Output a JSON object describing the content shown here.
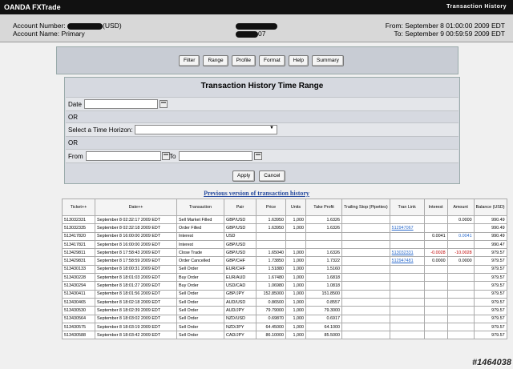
{
  "app": {
    "title": "OANDA FXTrade",
    "section": "Transaction History"
  },
  "account": {
    "number_label": "Account Number:",
    "number_suffix": "(USD)",
    "name_label": "Account Name: Primary",
    "mid_suffix": "07",
    "from": "From: September 8 01:00:00 2009 EDT",
    "to": "To: September 9 00:59:59 2009 EDT"
  },
  "toolbar": [
    "Filter",
    "Range",
    "Profile",
    "Format",
    "Help",
    "Summary"
  ],
  "range": {
    "title": "Transaction History Time Range",
    "date_label": "Date",
    "or1": "OR",
    "horizon_label": "Select a Time Horizon:",
    "or2": "OR",
    "from_label": "From",
    "to_label": "To",
    "apply": "Apply",
    "cancel": "Cancel"
  },
  "prev_link": "Previous version of transaction history",
  "table": {
    "headers": [
      "Ticket++",
      "Date++",
      "Transaction",
      "Pair",
      "Price",
      "Units",
      "Take Profit",
      "Trailing Stop (Pipettes)",
      "Tran Link",
      "Interest",
      "Amount",
      "Balance (USD)"
    ],
    "rows": [
      [
        "513032331",
        "September 8 02:32:17 2009 EDT",
        "Sell Market Filled",
        "GBP/USD",
        "1.63950",
        "1,000",
        "1.6326",
        "",
        "",
        "",
        "0.0000",
        "990.49"
      ],
      [
        "513032335",
        "September 8 02:32:18 2009 EDT",
        "Order Filled",
        "GBP/USD",
        "1.63950",
        "1,000",
        "1.6326",
        "",
        "512947067",
        "",
        "",
        "990.49"
      ],
      [
        "513417820",
        "September 8 16:00:00 2009 EDT",
        "Interest",
        "USD",
        "",
        "",
        "",
        "",
        "",
        "0.0041",
        "0.0041",
        "990.49"
      ],
      [
        "513417821",
        "September 8 16:00:00 2009 EDT",
        "Interest",
        "GBP/USD",
        "",
        "",
        "",
        "",
        "",
        "",
        "",
        "990.47"
      ],
      [
        "513429811",
        "September 8 17:58:43 2009 EDT",
        "Close Trade",
        "GBP/USD",
        "1.65040",
        "1,000",
        "1.6326",
        "",
        "513032331",
        "-0.0028",
        "-10.0028",
        "979.57"
      ],
      [
        "513429831",
        "September 8 17:58:59 2009 EDT",
        "Order Cancelled",
        "GBP/CHF",
        "1.73850",
        "1,000",
        "1.7322",
        "",
        "512947481",
        "0.0000",
        "0.0000",
        "979.57"
      ],
      [
        "513430133",
        "September 8 18:00:31 2009 EDT",
        "Sell Order",
        "EUR/CHF",
        "1.51880",
        "1,000",
        "1.5160",
        "",
        "",
        "",
        "",
        "979.57"
      ],
      [
        "513430228",
        "September 8 18:01:03 2009 EDT",
        "Buy Order",
        "EUR/AUD",
        "1.67480",
        "1,000",
        "1.6818",
        "",
        "",
        "",
        "",
        "979.57"
      ],
      [
        "513430294",
        "September 8 18:01:27 2009 EDT",
        "Buy Order",
        "USD/CAD",
        "1.06980",
        "1,000",
        "1.0818",
        "",
        "",
        "",
        "",
        "979.57"
      ],
      [
        "513430411",
        "September 8 18:01:56 2009 EDT",
        "Sell Order",
        "GBP/JPY",
        "152.85000",
        "1,000",
        "151.8500",
        "",
        "",
        "",
        "",
        "979.57"
      ],
      [
        "513430465",
        "September 8 18:02:18 2009 EDT",
        "Sell Order",
        "AUD/USD",
        "0.86500",
        "1,000",
        "0.8557",
        "",
        "",
        "",
        "",
        "979.57"
      ],
      [
        "513430530",
        "September 8 18:02:39 2009 EDT",
        "Sell Order",
        "AUD/JPY",
        "79.79000",
        "1,000",
        "79.3000",
        "",
        "",
        "",
        "",
        "979.57"
      ],
      [
        "513430564",
        "September 8 18:03:02 2009 EDT",
        "Sell Order",
        "NZD/USD",
        "0.69870",
        "1,000",
        "0.6917",
        "",
        "",
        "",
        "",
        "979.57"
      ],
      [
        "513430575",
        "September 8 18:03:19 2009 EDT",
        "Sell Order",
        "NZD/JPY",
        "64.45000",
        "1,000",
        "64.1000",
        "",
        "",
        "",
        "",
        "979.57"
      ],
      [
        "513430588",
        "September 8 18:03:42 2009 EDT",
        "Sell Order",
        "CAD/JPY",
        "86.10000",
        "1,000",
        "85.5000",
        "",
        "",
        "",
        "",
        "979.57"
      ]
    ]
  },
  "watermark": "#1464038"
}
